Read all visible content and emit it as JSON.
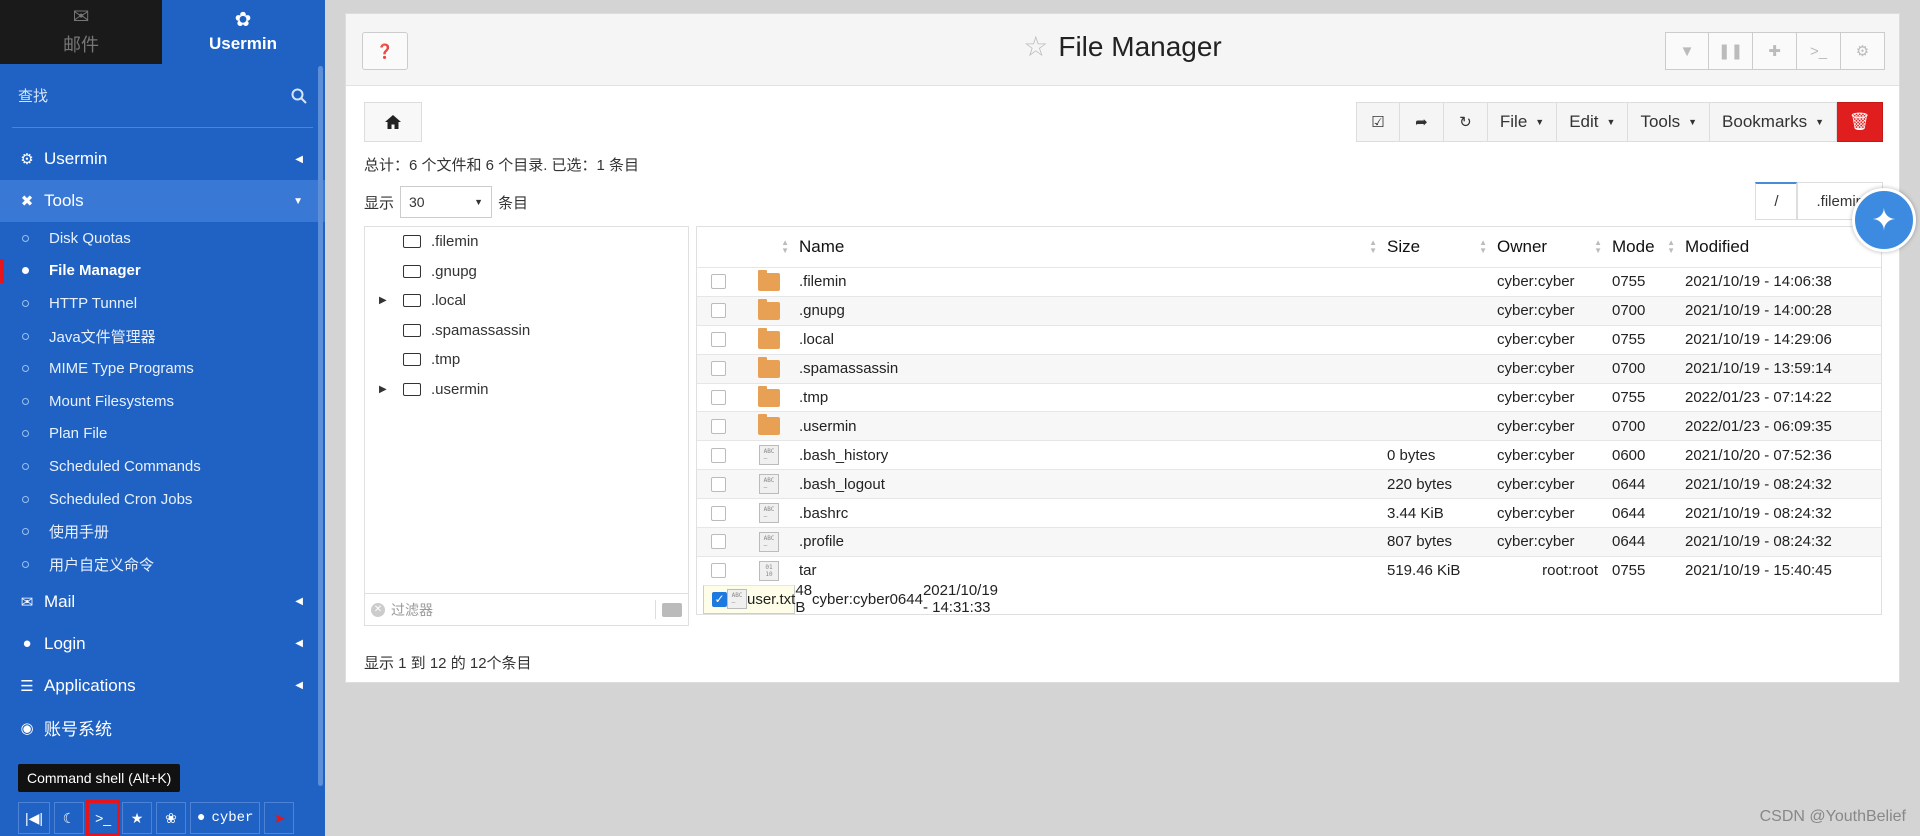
{
  "sidebar": {
    "tabs": [
      {
        "label": "邮件",
        "icon": "envelope-icon"
      },
      {
        "label": "Usermin",
        "icon": "usermin-logo-icon"
      }
    ],
    "search_placeholder": "查找",
    "categories_top": [
      {
        "label": "Usermin",
        "icon": "gear-icon"
      },
      {
        "label": "Tools",
        "icon": "tools-icon"
      }
    ],
    "tools_items": [
      {
        "label": "Disk Quotas"
      },
      {
        "label": "File Manager"
      },
      {
        "label": "HTTP Tunnel"
      },
      {
        "label": "Java文件管理器"
      },
      {
        "label": "MIME Type Programs"
      },
      {
        "label": "Mount Filesystems"
      },
      {
        "label": "Plan File"
      },
      {
        "label": "Scheduled Commands"
      },
      {
        "label": "Scheduled Cron Jobs"
      },
      {
        "label": "使用手册"
      },
      {
        "label": "用户自定义命令"
      }
    ],
    "categories_bottom": [
      {
        "label": "Mail",
        "icon": "envelope-icon"
      },
      {
        "label": "Login",
        "icon": "user-icon"
      },
      {
        "label": "Applications",
        "icon": "applications-icon"
      },
      {
        "label": "账号系统",
        "icon": "account-icon"
      }
    ],
    "tooltip": "Command shell (Alt+K)",
    "bottom_user": "cyber"
  },
  "header": {
    "title": "File Manager",
    "buttons": [
      "filter-icon",
      "columns-icon",
      "plus-icon",
      "terminal-icon",
      "gear-icon"
    ]
  },
  "toolbar": {
    "menus": [
      "File",
      "Edit",
      "Tools",
      "Bookmarks"
    ]
  },
  "summary": "总计：6 个文件和 6 个目录. 已选：1 条目",
  "show": {
    "prefix": "显示",
    "value": "30",
    "suffix": "条目"
  },
  "path_tabs": [
    "/",
    ".filemin"
  ],
  "tree": [
    {
      "name": ".filemin",
      "expandable": false
    },
    {
      "name": ".gnupg",
      "expandable": false
    },
    {
      "name": ".local",
      "expandable": true
    },
    {
      "name": ".spamassassin",
      "expandable": false
    },
    {
      "name": ".tmp",
      "expandable": false
    },
    {
      "name": ".usermin",
      "expandable": true
    }
  ],
  "filter_placeholder": "过滤器",
  "table": {
    "headers": {
      "name": "Name",
      "size": "Size",
      "owner": "Owner",
      "mode": "Mode",
      "modified": "Modified"
    },
    "rows": [
      {
        "type": "folder",
        "name": ".filemin",
        "size": "",
        "owner": "cyber:cyber",
        "mode": "0755",
        "modified": "2021/10/19 - 14:06:38",
        "checked": false
      },
      {
        "type": "folder",
        "name": ".gnupg",
        "size": "",
        "owner": "cyber:cyber",
        "mode": "0700",
        "modified": "2021/10/19 - 14:00:28",
        "checked": false
      },
      {
        "type": "folder",
        "name": ".local",
        "size": "",
        "owner": "cyber:cyber",
        "mode": "0755",
        "modified": "2021/10/19 - 14:29:06",
        "checked": false
      },
      {
        "type": "folder",
        "name": ".spamassassin",
        "size": "",
        "owner": "cyber:cyber",
        "mode": "0700",
        "modified": "2021/10/19 - 13:59:14",
        "checked": false
      },
      {
        "type": "folder",
        "name": ".tmp",
        "size": "",
        "owner": "cyber:cyber",
        "mode": "0755",
        "modified": "2022/01/23 - 07:14:22",
        "checked": false
      },
      {
        "type": "folder",
        "name": ".usermin",
        "size": "",
        "owner": "cyber:cyber",
        "mode": "0700",
        "modified": "2022/01/23 - 06:09:35",
        "checked": false
      },
      {
        "type": "text",
        "name": ".bash_history",
        "size": "0 bytes",
        "owner": "cyber:cyber",
        "mode": "0600",
        "modified": "2021/10/20 - 07:52:36",
        "checked": false
      },
      {
        "type": "text",
        "name": ".bash_logout",
        "size": "220 bytes",
        "owner": "cyber:cyber",
        "mode": "0644",
        "modified": "2021/10/19 - 08:24:32",
        "checked": false
      },
      {
        "type": "text",
        "name": ".bashrc",
        "size": "3.44 KiB",
        "owner": "cyber:cyber",
        "mode": "0644",
        "modified": "2021/10/19 - 08:24:32",
        "checked": false
      },
      {
        "type": "text",
        "name": ".profile",
        "size": "807 bytes",
        "owner": "cyber:cyber",
        "mode": "0644",
        "modified": "2021/10/19 - 08:24:32",
        "checked": false
      },
      {
        "type": "binary",
        "name": "tar",
        "size": "519.46 KiB",
        "owner": "root:root",
        "mode": "0755",
        "modified": "2021/10/19 - 15:40:45",
        "checked": false
      },
      {
        "type": "text",
        "name": "user.txt",
        "size": "48 B",
        "owner": "cyber:cyber",
        "mode": "0644",
        "modified": "2021/10/19 - 14:31:33",
        "checked": true
      }
    ]
  },
  "footer_info": "显示 1 到 12 的 12个条目",
  "watermark": "CSDN @YouthBelief"
}
